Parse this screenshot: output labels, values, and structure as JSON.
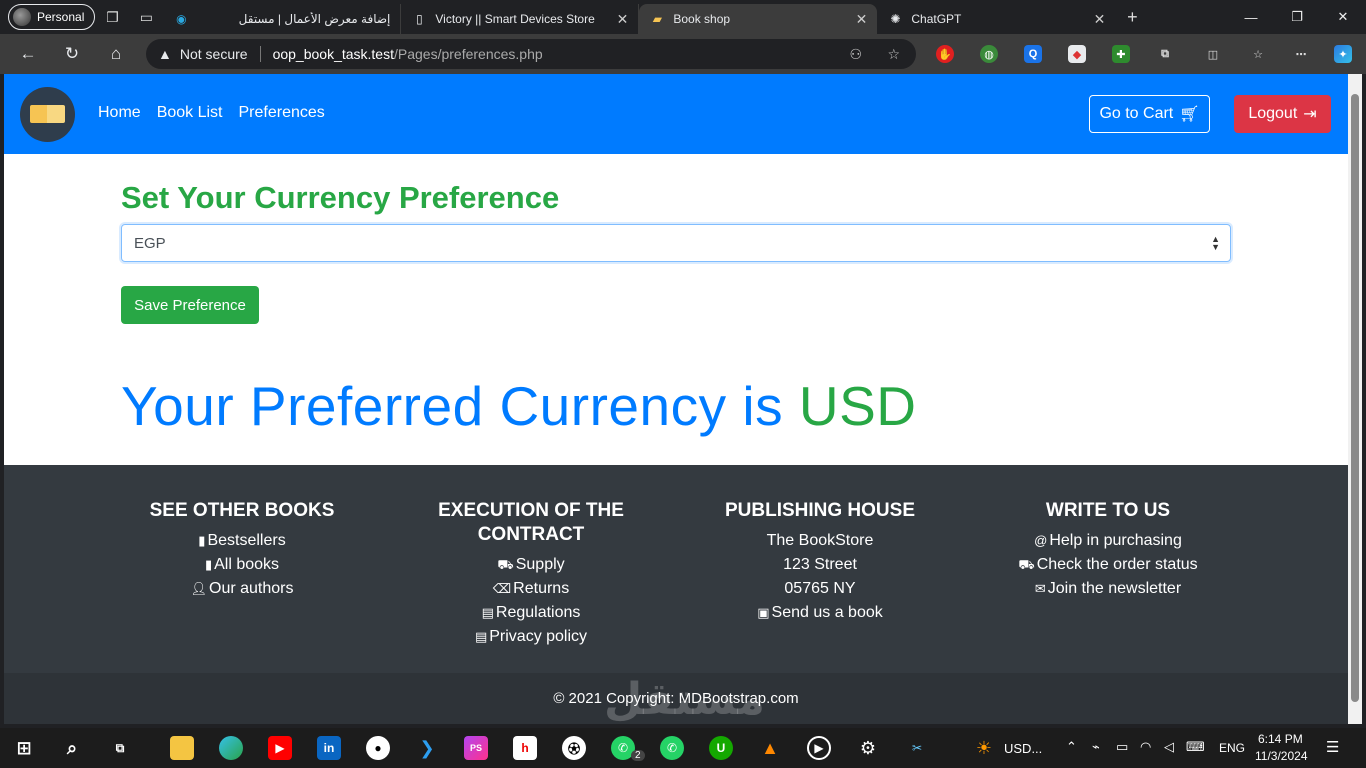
{
  "browser": {
    "profile_label": "Personal",
    "tabs": [
      {
        "title": "إضافة معرض الأعمال | مستقل"
      },
      {
        "title": "Victory || Smart Devices Store"
      },
      {
        "title": "Book shop"
      },
      {
        "title": "ChatGPT"
      }
    ],
    "security_label": "Not secure",
    "url_host": "oop_book_task.test",
    "url_path": "/Pages/preferences.php"
  },
  "navbar": {
    "links": [
      "Home",
      "Book List",
      "Preferences"
    ],
    "cart_label": "Go to Cart",
    "logout_label": "Logout"
  },
  "preference": {
    "title": "Set Your Currency Preference",
    "selected_currency": "EGP",
    "save_label": "Save Preference",
    "result_prefix": "Your Preferred Currency is",
    "result_currency": "USD"
  },
  "footer": {
    "columns": [
      {
        "title": "SEE OTHER BOOKS",
        "items": [
          "Bestsellers",
          "All books",
          "Our authors"
        ]
      },
      {
        "title_line1": "EXECUTION OF THE",
        "title_line2": "CONTRACT",
        "items": [
          "Supply",
          "Returns",
          "Regulations",
          "Privacy policy"
        ]
      },
      {
        "title": "PUBLISHING HOUSE",
        "items": [
          "The BookStore",
          "123 Street",
          "05765 NY",
          "Send us a book"
        ]
      },
      {
        "title": "WRITE TO US",
        "items": [
          "Help in purchasing",
          "Check the order status",
          "Join the newsletter"
        ]
      }
    ],
    "copyright": "© 2021 Copyright: MDBootstrap.com",
    "watermark": "مستقل"
  },
  "taskbar": {
    "pinned_label": "USD...",
    "language": "ENG",
    "time": "6:14 PM",
    "date": "11/3/2024",
    "whatsapp_badge": "2"
  },
  "colors": {
    "primary": "#007bff",
    "success": "#28a745",
    "danger": "#dc3545",
    "footer_bg": "#343a40"
  }
}
